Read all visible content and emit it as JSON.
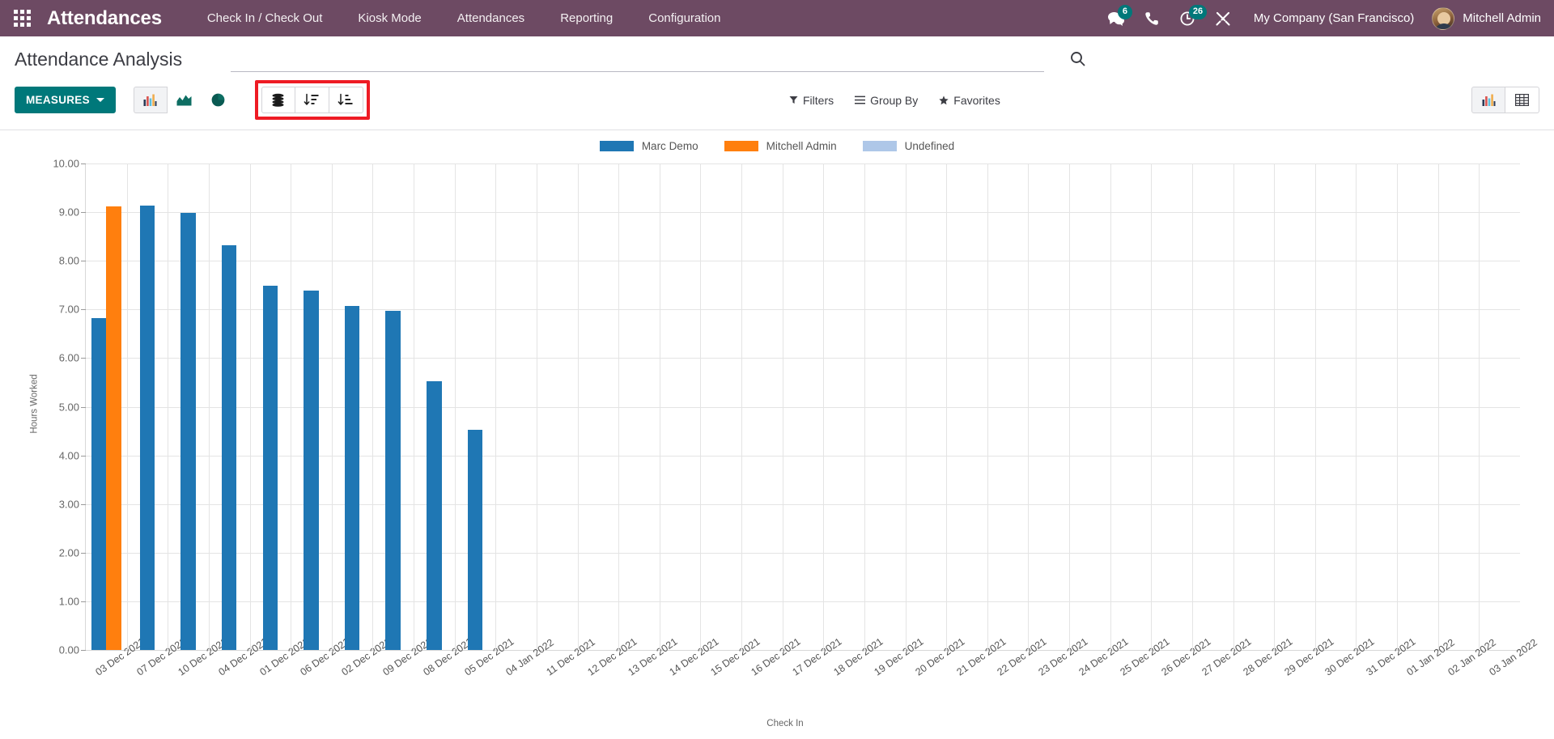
{
  "navbar": {
    "apps_icon": "apps-grid-icon",
    "brand": "Attendances",
    "menu": [
      {
        "label": "Check In / Check Out"
      },
      {
        "label": "Kiosk Mode"
      },
      {
        "label": "Attendances"
      },
      {
        "label": "Reporting"
      },
      {
        "label": "Configuration"
      }
    ],
    "messages_icon": "chat-bubble-icon",
    "messages_count": "6",
    "phone_icon": "phone-icon",
    "activities_icon": "clock-icon",
    "activities_count": "26",
    "debug_icon": "wrench-screwdriver-icon",
    "company": "My Company (San Francisco)",
    "user_name": "Mitchell Admin",
    "avatar_icon": "avatar"
  },
  "control_panel": {
    "title": "Attendance Analysis",
    "search_placeholder": "",
    "search_value": "",
    "search_icon": "search-icon",
    "measures_label": "MEASURES",
    "chart_type_buttons": [
      {
        "name": "bar-chart-icon",
        "active": true
      },
      {
        "name": "line-chart-icon",
        "active": false
      },
      {
        "name": "pie-chart-icon",
        "active": false
      }
    ],
    "highlighted_buttons": [
      {
        "name": "stacked-bars-icon",
        "active": false
      },
      {
        "name": "sort-descending-icon",
        "active": false
      },
      {
        "name": "sort-ascending-icon",
        "active": false
      }
    ],
    "filters_label": "Filters",
    "group_by_label": "Group By",
    "favorites_label": "Favorites",
    "view_switcher": [
      {
        "name": "graph-view-icon",
        "active": true
      },
      {
        "name": "pivot-view-icon",
        "active": false
      }
    ]
  },
  "chart_data": {
    "type": "bar",
    "title": "",
    "xlabel": "Check In",
    "ylabel": "Hours Worked",
    "ylim": [
      0,
      10
    ],
    "yticks": [
      "0.00",
      "1.00",
      "2.00",
      "3.00",
      "4.00",
      "5.00",
      "6.00",
      "7.00",
      "8.00",
      "9.00",
      "10.00"
    ],
    "grid": true,
    "legend_position": "top",
    "colors": {
      "Marc Demo": "#1f77b4",
      "Mitchell Admin": "#ff7f0e",
      "Undefined": "#aec7e8"
    },
    "legend": [
      {
        "name": "Marc Demo",
        "color": "#1f77b4"
      },
      {
        "name": "Mitchell Admin",
        "color": "#ff7f0e"
      },
      {
        "name": "Undefined",
        "color": "#aec7e8"
      }
    ],
    "categories": [
      "03 Dec 2021",
      "07 Dec 2021",
      "10 Dec 2021",
      "04 Dec 2021",
      "01 Dec 2021",
      "06 Dec 2021",
      "02 Dec 2021",
      "09 Dec 2021",
      "08 Dec 2021",
      "05 Dec 2021",
      "04 Jan 2022",
      "11 Dec 2021",
      "12 Dec 2021",
      "13 Dec 2021",
      "14 Dec 2021",
      "15 Dec 2021",
      "16 Dec 2021",
      "17 Dec 2021",
      "18 Dec 2021",
      "19 Dec 2021",
      "20 Dec 2021",
      "21 Dec 2021",
      "22 Dec 2021",
      "23 Dec 2021",
      "24 Dec 2021",
      "25 Dec 2021",
      "26 Dec 2021",
      "27 Dec 2021",
      "28 Dec 2021",
      "29 Dec 2021",
      "30 Dec 2021",
      "31 Dec 2021",
      "01 Jan 2022",
      "02 Jan 2022",
      "03 Jan 2022"
    ],
    "bars": [
      {
        "category": "03 Dec 2021",
        "value": 6.82,
        "series": "Marc Demo"
      },
      {
        "category": "03 Dec 2021",
        "value": 9.12,
        "series": "Mitchell Admin"
      },
      {
        "category": "07 Dec 2021",
        "value": 9.13,
        "series": "Marc Demo"
      },
      {
        "category": "10 Dec 2021",
        "value": 8.98,
        "series": "Marc Demo"
      },
      {
        "category": "04 Dec 2021",
        "value": 8.32,
        "series": "Marc Demo"
      },
      {
        "category": "01 Dec 2021",
        "value": 7.48,
        "series": "Marc Demo"
      },
      {
        "category": "06 Dec 2021",
        "value": 7.38,
        "series": "Marc Demo"
      },
      {
        "category": "02 Dec 2021",
        "value": 7.08,
        "series": "Marc Demo"
      },
      {
        "category": "09 Dec 2021",
        "value": 6.97,
        "series": "Marc Demo"
      },
      {
        "category": "08 Dec 2021",
        "value": 5.52,
        "series": "Marc Demo"
      },
      {
        "category": "05 Dec 2021",
        "value": 4.52,
        "series": "Marc Demo"
      }
    ]
  }
}
